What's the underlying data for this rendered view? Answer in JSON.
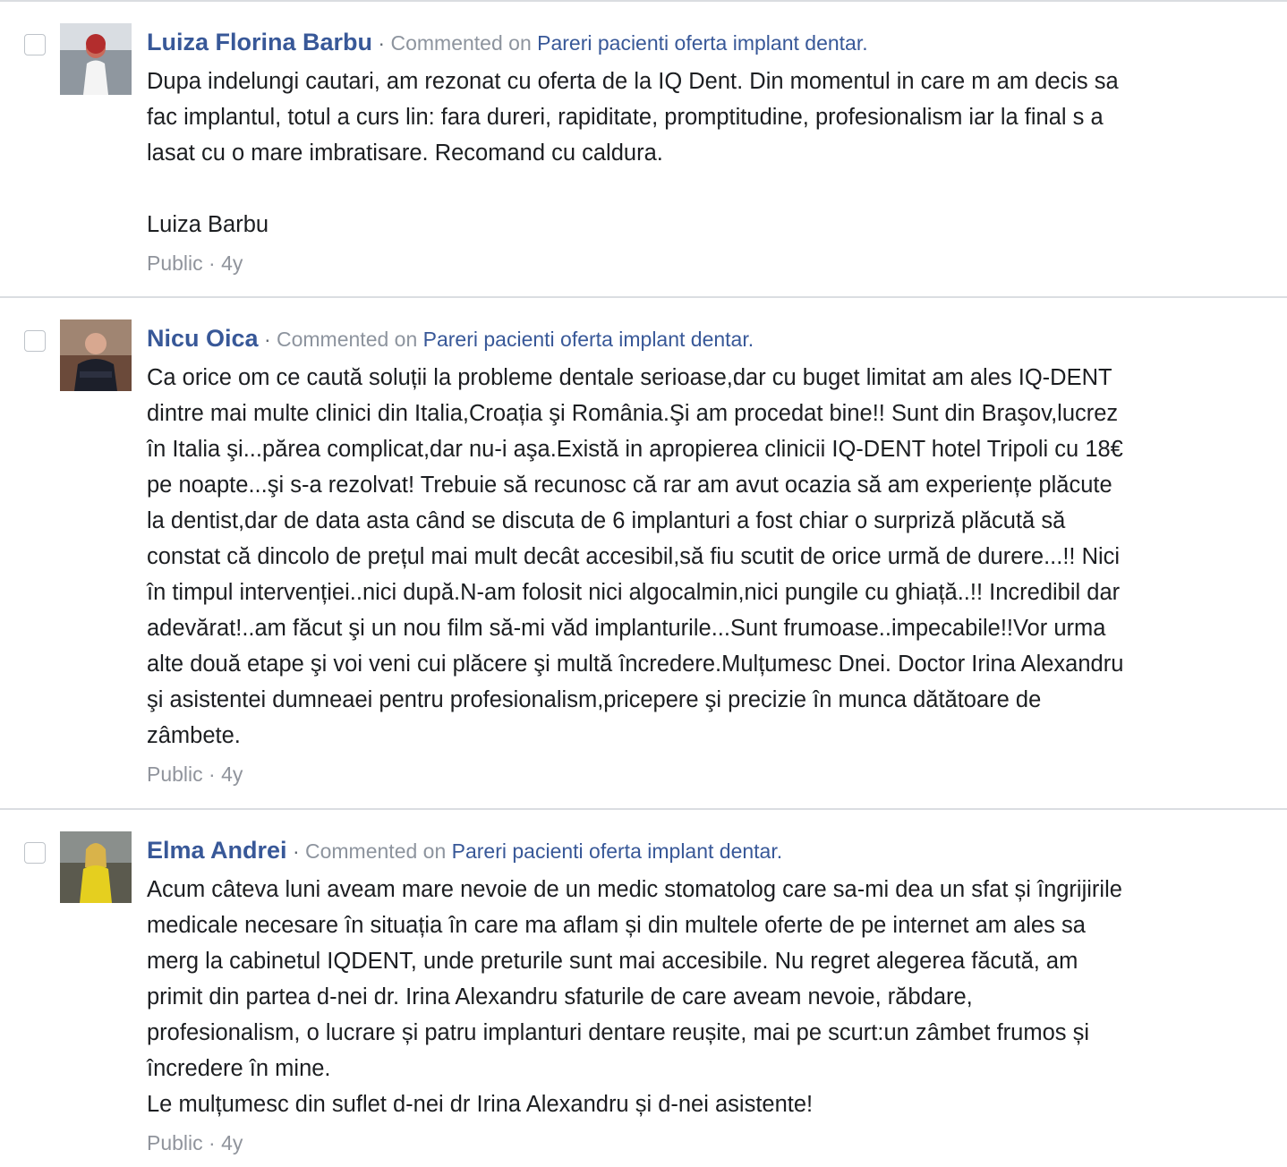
{
  "comments": [
    {
      "author": "Luiza Florina Barbu",
      "separator": "·",
      "action": "Commented on",
      "target": "Pareri pacienti oferta implant dentar.",
      "lines": [
        "Dupa indelungi cautari, am rezonat cu oferta de la IQ Dent. Din momentul in care m am decis sa",
        "fac implantul, totul a curs lin: fara dureri, rapiditate, promptitudine, profesionalism iar la final s a",
        "lasat cu o mare imbratisare. Recomand cu caldura.",
        "",
        "Luiza Barbu"
      ],
      "privacy": "Public",
      "meta_separator": "·",
      "age": "4y"
    },
    {
      "author": "Nicu Oica",
      "separator": "·",
      "action": "Commented on",
      "target": "Pareri pacienti oferta implant dentar.",
      "lines": [
        "Ca orice om ce caută soluții la probleme dentale serioase,dar cu buget limitat am ales IQ-DENT",
        "dintre mai multe clinici din Italia,Croația şi România.Şi am procedat bine!! Sunt din Braşov,lucrez",
        "în Italia şi...părea complicat,dar nu-i aşa.Există in apropierea clinicii IQ-DENT hotel Tripoli cu 18€",
        "pe noapte...şi s-a rezolvat! Trebuie să recunosc că rar am avut ocazia să am experiențe plăcute",
        "la dentist,dar de data asta când se discuta de 6 implanturi a fost chiar o surpriză plăcută să",
        "constat că dincolo de prețul mai mult decât accesibil,să fiu scutit de orice urmă de durere...!! Nici",
        "în timpul intervenției..nici după.N-am folosit nici algocalmin,nici pungile cu ghiață..!! Incredibil dar",
        "adevărat!..am făcut şi un nou film să-mi văd implanturile...Sunt frumoase..impecabile!!Vor urma",
        "alte două etape şi voi veni cui plăcere şi multă încredere.Mulțumesc Dnei. Doctor Irina Alexandru",
        "şi asistentei dumneaei pentru profesionalism,pricepere şi precizie în munca dătătoare de",
        "zâmbete."
      ],
      "privacy": "Public",
      "meta_separator": "·",
      "age": "4y"
    },
    {
      "author": "Elma Andrei",
      "separator": "·",
      "action": "Commented on",
      "target": "Pareri pacienti oferta implant dentar.",
      "lines": [
        "Acum câteva luni aveam mare nevoie de un medic stomatolog care sa-mi dea un sfat și îngrijirile",
        "medicale necesare în situația în care ma aflam și din multele oferte de pe internet am ales sa",
        "merg la cabinetul IQDENT, unde preturile sunt mai accesibile. Nu regret alegerea făcută, am",
        "primit din partea d-nei dr. Irina Alexandru sfaturile de care aveam nevoie, răbdare,",
        "profesionalism, o lucrare și patru implanturi dentare reușite, mai pe scurt:un zâmbet frumos și",
        "încredere în mine.",
        "Le mulțumesc din suflet d-nei dr Irina Alexandru și d-nei asistente!"
      ],
      "privacy": "Public",
      "meta_separator": "·",
      "age": "4y"
    }
  ],
  "colors": {
    "link": "#385898",
    "muted": "#90949c",
    "text": "#1c1e21",
    "divider": "#dadde1"
  },
  "icons": [
    "checkbox",
    "avatar-photo"
  ]
}
